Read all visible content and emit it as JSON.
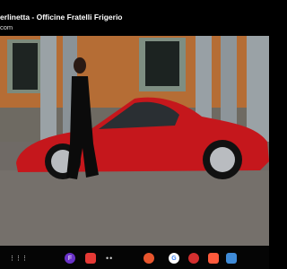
{
  "video": {
    "title": "erlinetta - Officine Fratelli Frigerio",
    "channel_url": "com"
  },
  "scene": {
    "subject": "red-classic-coupe",
    "person": "woman-in-black-dress",
    "setting": "cobblestone-courtyard"
  },
  "taskbar": {
    "apps": [
      {
        "name": "app-drawer-icon",
        "label": "⋮⋮⋮",
        "color": "#ffffff"
      },
      {
        "name": "profile-icon",
        "label": "F",
        "color": "#6a32c9"
      },
      {
        "name": "app-red-icon",
        "label": "",
        "color": "#e53935"
      },
      {
        "name": "dots-icon",
        "label": "••",
        "color": "#cccccc"
      },
      {
        "name": "files-icon",
        "label": "",
        "color": "#e8552d"
      },
      {
        "name": "google-icon",
        "label": "G",
        "color": "#ffffff"
      },
      {
        "name": "vpn-icon",
        "label": "",
        "color": "#d32f2f"
      },
      {
        "name": "gallery-icon",
        "label": "",
        "color": "#ff5a3c"
      },
      {
        "name": "store-icon",
        "label": "",
        "color": "#3f8bd8"
      }
    ]
  }
}
